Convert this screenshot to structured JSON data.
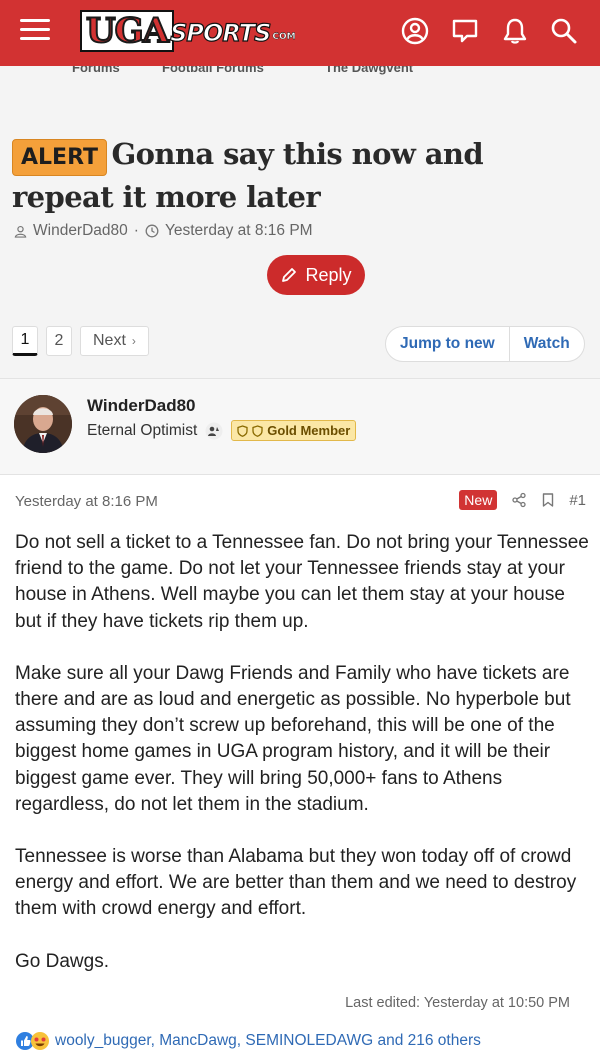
{
  "header": {
    "logo_main": "UGA",
    "logo_sports": "SPORTS",
    "logo_com": "COM",
    "icons": [
      "menu-icon",
      "account-icon",
      "chat-icon",
      "alerts-icon",
      "search-icon"
    ]
  },
  "breadcrumbs": [
    "Forums",
    "Football Forums",
    "The Dawgvent"
  ],
  "thread": {
    "prefix": "ALERT",
    "title": "Gonna say this now and repeat it more later",
    "author": "WinderDad80",
    "separator": "·",
    "time": "Yesterday at 8:16 PM",
    "reply_label": "Reply"
  },
  "pagination": {
    "pages": [
      "1",
      "2"
    ],
    "current": "1",
    "next_label": "Next",
    "next_arrow": "›"
  },
  "thread_actions": {
    "jump_label": "Jump to new",
    "watch_label": "Watch"
  },
  "post": {
    "username": "WinderDad80",
    "user_title": "Eternal Optimist",
    "member_badge": "Gold Member",
    "date": "Yesterday at 8:16 PM",
    "new_label": "New",
    "post_number": "#1",
    "paragraphs": [
      "Do not sell a ticket to a Tennessee fan. Do not bring your Tennessee friend to the game. Do not let your Tennessee friends stay at your house in Athens. Well maybe you can let them stay at your house but if they have tickets rip them up.",
      "Make sure all your Dawg Friends and Family who have tickets are there and are as loud and energetic as possible. No hyperbole but assuming they don’t screw up beforehand, this will be one of the biggest home games in UGA program history, and it will be their biggest game ever. They will bring 50,000+ fans to Athens regardless, do not let them in the stadium.",
      "Tennessee is worse than Alabama but they won today off of crowd energy and effort. We are better than them and we need to destroy them with crowd energy and effort.",
      "Go Dawgs."
    ],
    "last_edited": "Last edited: Yesterday at 10:50 PM",
    "reactions_text": "wooly_bugger, MancDawg, SEMINOLEDAWG and 216 others"
  },
  "colors": {
    "header_red": "#d23232",
    "reply_red": "#cc2b2b",
    "alert_orange": "#f4a03a",
    "link_blue": "#2f6ab5",
    "gold_badge": "#fbe7a6"
  }
}
